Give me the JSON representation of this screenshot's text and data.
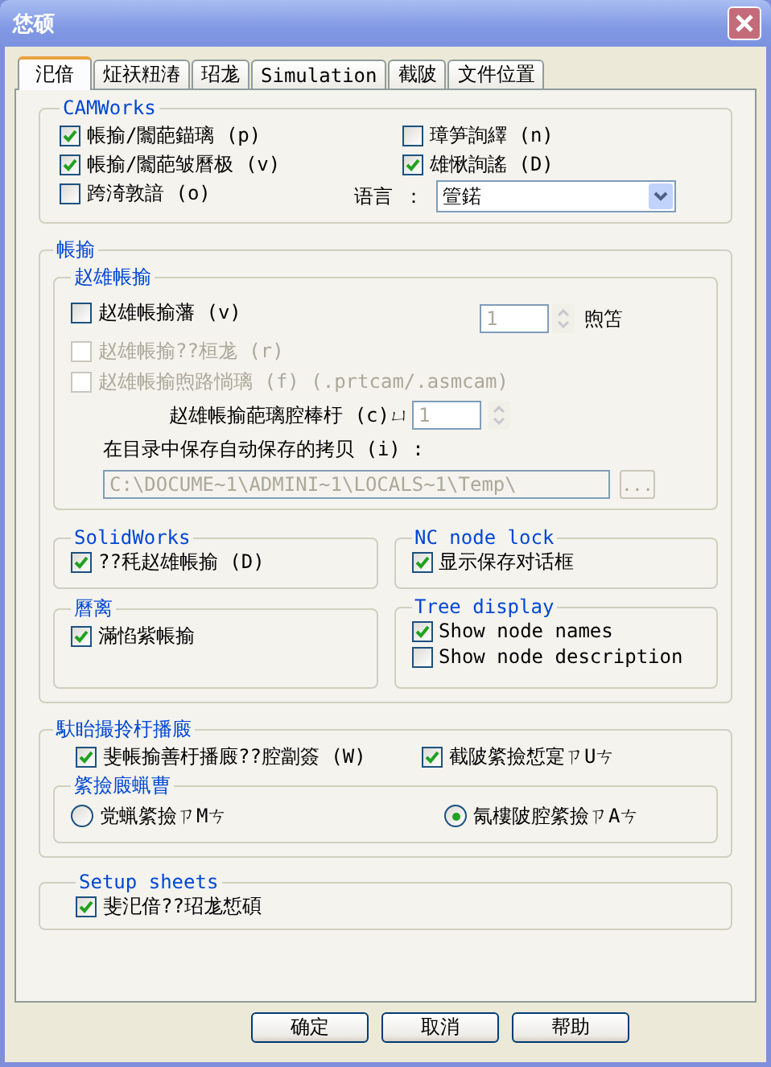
{
  "window": {
    "title": "恷硕"
  },
  "tabs": [
    {
      "label": "汜偣",
      "selected": true
    },
    {
      "label": "炡祆粈湷",
      "selected": false
    },
    {
      "label": "玿尨",
      "selected": false
    },
    {
      "label": "Simulation",
      "selected": false
    },
    {
      "label": "截陂",
      "selected": false
    },
    {
      "label": "文件位置",
      "selected": false
    }
  ],
  "camworks": {
    "title": "CAMWorks",
    "options": [
      {
        "label": "帳揄/闟葩錨璃 (p)",
        "checked": true
      },
      {
        "label": "璋笋詢繹 (n)",
        "checked": false
      },
      {
        "label": "帳揄/闟葩皱曆极 (v)",
        "checked": true
      },
      {
        "label": "雄愀詢謠 (D)",
        "checked": true
      },
      {
        "label": "跨渏敦諳 (o)",
        "checked": false
      }
    ],
    "language": {
      "label": "语言 ：",
      "value": "箮鍩"
    }
  },
  "autosave": {
    "title": "帳揄",
    "subtitle": "赵雄帳揄",
    "interval": {
      "label": "赵雄帳揄藩 (v)",
      "checked": false,
      "disabled": false,
      "value": "1",
      "unit": "煦笘"
    },
    "options": [
      {
        "label": "赵雄帳揄??桓尨 (r)",
        "checked": false,
        "disabled": true
      },
      {
        "label": "赵雄帳揄煦路惝璃 (f) (.prtcam/.asmcam)",
        "checked": false,
        "disabled": true
      }
    ],
    "count": {
      "label": "赵雄帳揄葩璃腔棒杅 (c)ㄩ",
      "value": "1"
    },
    "folder": {
      "label": "在目录中保存自动保存的拷贝 (i) :",
      "value": "C:\\DOCUME~1\\ADMINI~1\\LOCALS~1\\Temp\\",
      "browse": "..."
    }
  },
  "solidworks": {
    "title": "SolidWorks",
    "option": {
      "label": "??秏赵雄帳揄 (D)",
      "checked": true
    }
  },
  "nc_node_lock": {
    "title": "NC node lock",
    "option": {
      "label": "显示保存对话框",
      "checked": true
    }
  },
  "section_5": {
    "title": "曆离",
    "option": {
      "label": "滿惂紫帳揄",
      "checked": true
    }
  },
  "tree_display": {
    "title": "Tree display",
    "options": [
      {
        "label": "Show node names",
        "checked": true
      },
      {
        "label": "Show node description",
        "checked": false
      }
    ]
  },
  "section_7": {
    "title": "馱眙撮拎杅播廄",
    "options": [
      {
        "label": "斐帳揄善杅播廄??腔劏簽 (W)",
        "checked": true
      },
      {
        "label": "截陂綮撿惁寔ㄗUㄘ",
        "checked": true
      }
    ],
    "subtitle": "綮撿廄蝋曹",
    "radios": [
      {
        "label": "党蝋綮撿ㄗMㄘ",
        "selected": false
      },
      {
        "label": "氝樓陂腔綮撿ㄗAㄘ",
        "selected": true
      }
    ]
  },
  "setup_sheets": {
    "title": "Setup sheets",
    "option": {
      "label": "斐汜偣??玿尨惁碩",
      "checked": true
    }
  },
  "buttons": [
    "确定",
    "取消",
    "帮助"
  ]
}
